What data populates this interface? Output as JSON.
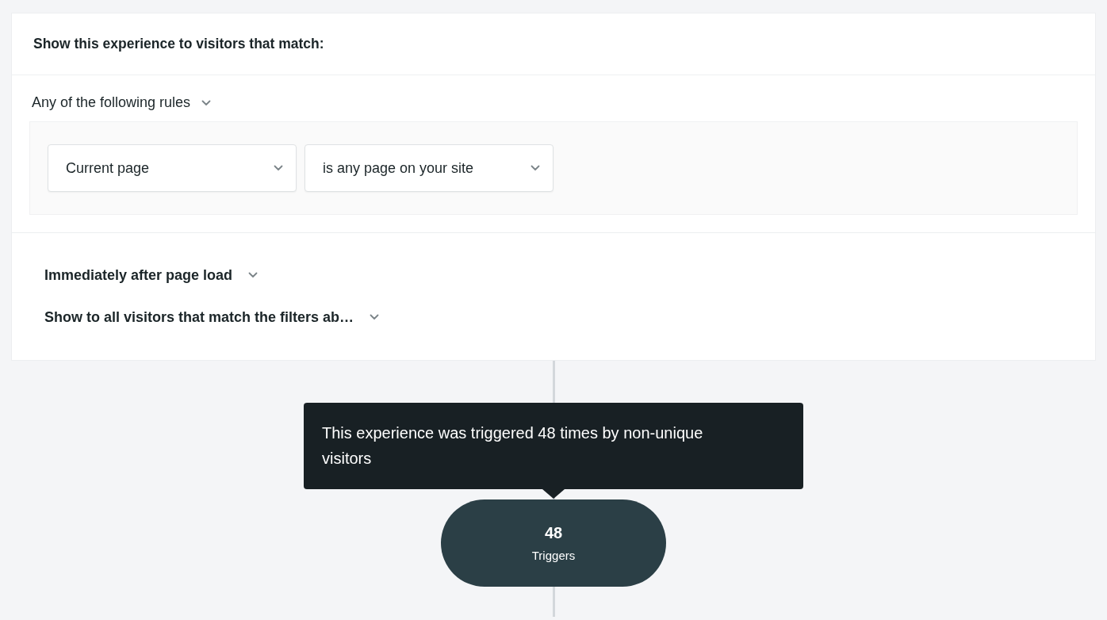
{
  "heading": "Show this experience to visitors that match:",
  "match_mode": {
    "label": "Any of the following rules"
  },
  "rule": {
    "fields": [
      {
        "value": "Current page"
      },
      {
        "value": "is any page on your site"
      }
    ]
  },
  "settings": [
    {
      "label": "Immediately after page load"
    },
    {
      "label": "Show to all visitors that match the filters ab…"
    }
  ],
  "node": {
    "count": "48",
    "label": "Triggers"
  },
  "tooltip": {
    "text": "This experience was triggered 48 times by non-unique visitors"
  }
}
